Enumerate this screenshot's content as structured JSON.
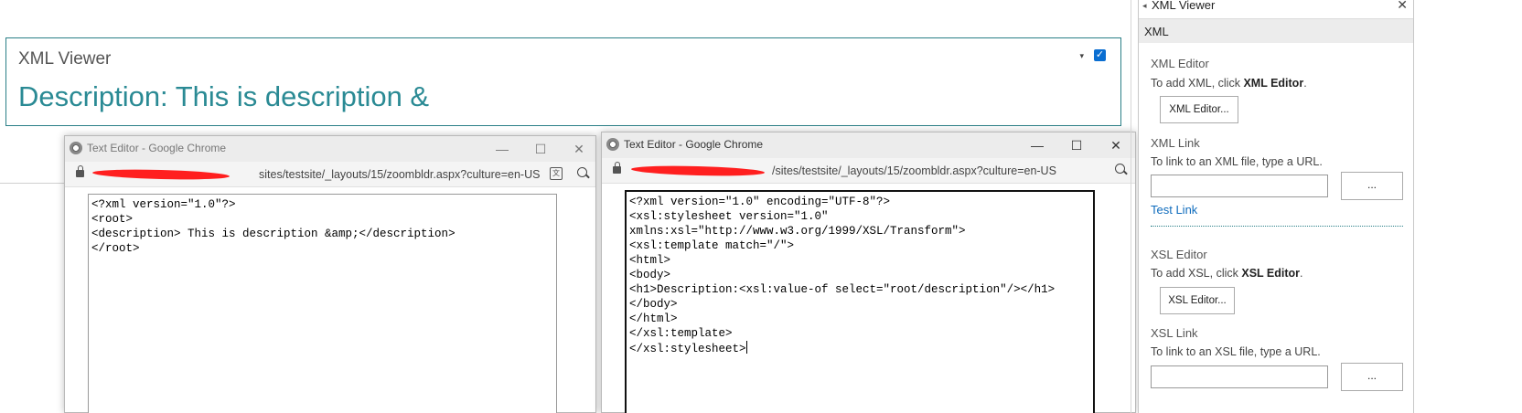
{
  "webpart": {
    "title": "XML Viewer",
    "description": "Description: This is description &",
    "menu_glyph": "▾",
    "check_glyph": "✓"
  },
  "xml_window": {
    "title": "Text Editor - Google Chrome",
    "url": "sites/testsite/_layouts/15/zoombldr.aspx?culture=en-US",
    "content": "<?xml version=\"1.0\"?>\n<root>\n<description> This is description &amp;</description>\n</root>",
    "minimize": "—",
    "maximize": "☐",
    "close": "✕",
    "translate_glyph": "文"
  },
  "xsl_window": {
    "title": "Text Editor - Google Chrome",
    "url": "/sites/testsite/_layouts/15/zoombldr.aspx?culture=en-US",
    "content": "<?xml version=\"1.0\" encoding=\"UTF-8\"?>\n<xsl:stylesheet version=\"1.0\"\nxmlns:xsl=\"http://www.w3.org/1999/XSL/Transform\">\n<xsl:template match=\"/\">\n<html>\n<body>\n<h1>Description:<xsl:value-of select=\"root/description\"/></h1>\n</body>\n</html>\n</xsl:template>\n</xsl:stylesheet>",
    "minimize": "—",
    "maximize": "☐",
    "close": "✕"
  },
  "toolpane": {
    "title": "XML Viewer",
    "arrow": "◂",
    "close": "✕",
    "section": "XML",
    "xml_editor_label": "XML Editor",
    "xml_editor_text_prefix": "To add XML, click ",
    "xml_editor_text_bold": "XML Editor",
    "xml_editor_text_suffix": ".",
    "xml_editor_button": "XML Editor...",
    "xml_link_label": "XML Link",
    "xml_link_text": "To link to an XML file, type a URL.",
    "xml_link_button": "...",
    "test_link": "Test Link",
    "xsl_editor_label": "XSL Editor",
    "xsl_editor_text_prefix": "To add XSL, click ",
    "xsl_editor_text_bold": "XSL Editor",
    "xsl_editor_text_suffix": ".",
    "xsl_editor_button": "XSL Editor...",
    "xsl_link_label": "XSL Link",
    "xsl_link_text": "To link to an XSL file, type a URL.",
    "xsl_link_button": "..."
  }
}
